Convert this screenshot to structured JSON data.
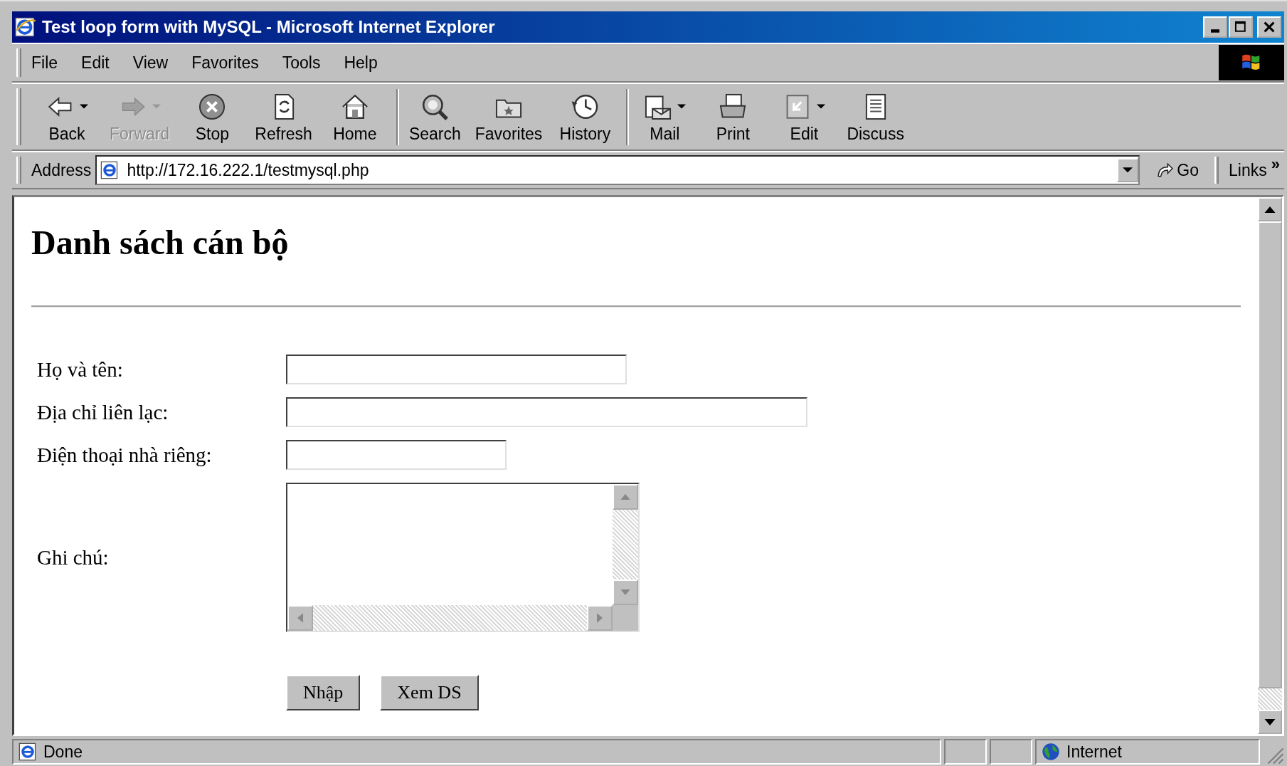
{
  "window": {
    "title": "Test loop form with MySQL - Microsoft Internet Explorer"
  },
  "menu": [
    "File",
    "Edit",
    "View",
    "Favorites",
    "Tools",
    "Help"
  ],
  "toolbar": [
    {
      "kind": "back",
      "label": "Back",
      "disabled": false,
      "dropdown": true,
      "separator_before": false
    },
    {
      "kind": "forward",
      "label": "Forward",
      "disabled": true,
      "dropdown": true,
      "separator_before": false
    },
    {
      "kind": "stop",
      "label": "Stop",
      "disabled": false,
      "dropdown": false,
      "separator_before": false
    },
    {
      "kind": "refresh",
      "label": "Refresh",
      "disabled": false,
      "dropdown": false,
      "separator_before": false
    },
    {
      "kind": "home",
      "label": "Home",
      "disabled": false,
      "dropdown": false,
      "separator_before": false
    },
    {
      "kind": "search",
      "label": "Search",
      "disabled": false,
      "dropdown": false,
      "separator_before": true
    },
    {
      "kind": "favorites",
      "label": "Favorites",
      "disabled": false,
      "dropdown": false,
      "separator_before": false
    },
    {
      "kind": "history",
      "label": "History",
      "disabled": false,
      "dropdown": false,
      "separator_before": false
    },
    {
      "kind": "mail",
      "label": "Mail",
      "disabled": false,
      "dropdown": true,
      "separator_before": true
    },
    {
      "kind": "print",
      "label": "Print",
      "disabled": false,
      "dropdown": false,
      "separator_before": false
    },
    {
      "kind": "edit",
      "label": "Edit",
      "disabled": false,
      "dropdown": true,
      "separator_before": false
    },
    {
      "kind": "discuss",
      "label": "Discuss",
      "disabled": false,
      "dropdown": false,
      "separator_before": false
    }
  ],
  "address_bar": {
    "label": "Address",
    "url": "http://172.16.222.1/testmysql.php",
    "go": "Go",
    "links": "Links",
    "more": "»"
  },
  "page": {
    "heading": "Danh sách cán bộ",
    "fields": [
      {
        "label": "Họ và tên:",
        "kind": "medium"
      },
      {
        "label": "Địa chỉ liên lạc:",
        "kind": "long"
      },
      {
        "label": "Điện thoại nhà riêng:",
        "kind": "short"
      },
      {
        "label": "Ghi chú:",
        "kind": "textarea"
      }
    ],
    "buttons": [
      "Nhập",
      "Xem DS"
    ]
  },
  "status_bar": {
    "text": "Done",
    "zone": "Internet"
  }
}
